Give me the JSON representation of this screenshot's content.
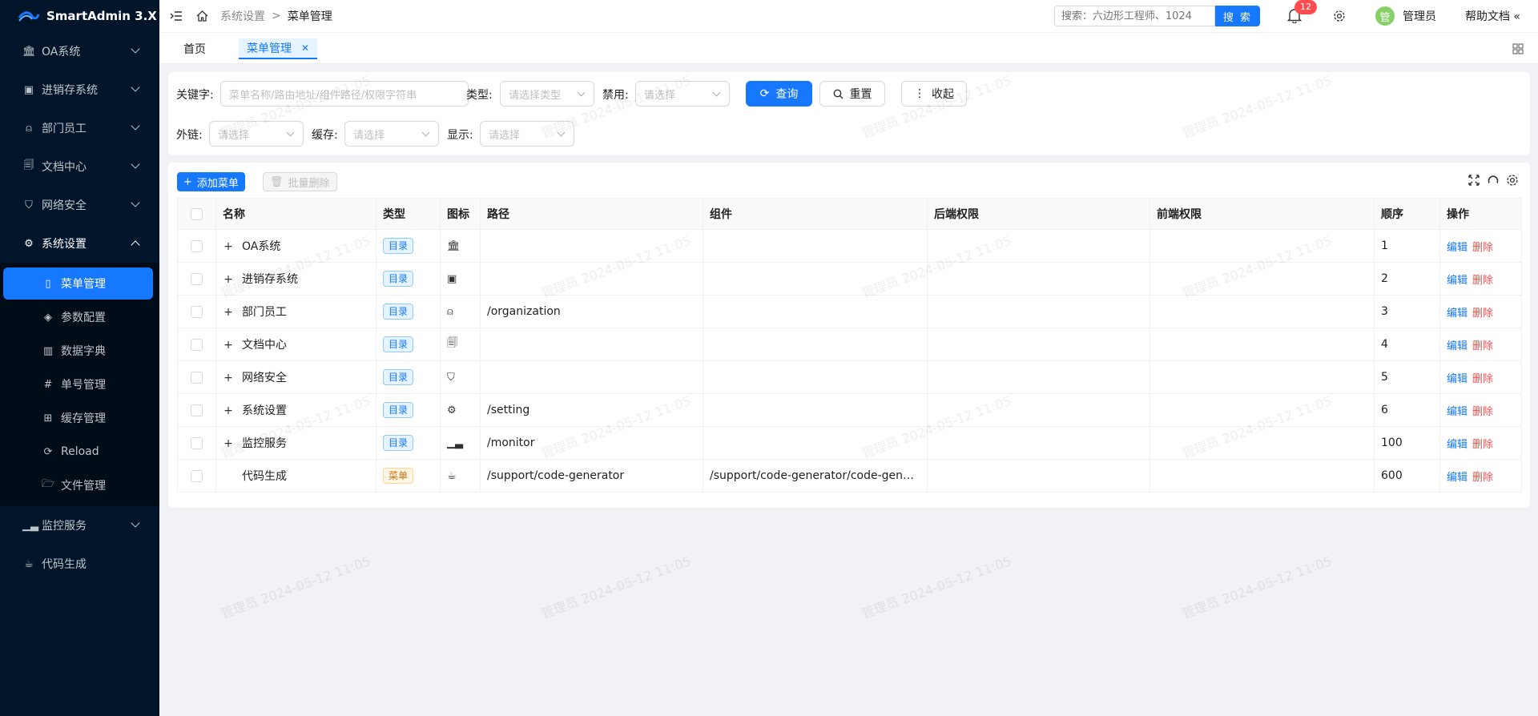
{
  "logo": {
    "title": "SmartAdmin 3.X"
  },
  "sidebar": {
    "groups_top": [
      {
        "label": "OA系统",
        "icon": "bank-icon"
      },
      {
        "label": "进销存系统",
        "icon": "calendar-icon"
      },
      {
        "label": "部门员工",
        "icon": "user-icon"
      },
      {
        "label": "文档中心",
        "icon": "file-search-icon"
      },
      {
        "label": "网络安全",
        "icon": "shield-icon"
      }
    ],
    "open_group": {
      "label": "系统设置",
      "icon": "gear-icon"
    },
    "sub_items": [
      {
        "label": "菜单管理",
        "icon": "file-icon"
      },
      {
        "label": "参数配置",
        "icon": "diamond-icon"
      },
      {
        "label": "数据字典",
        "icon": "barcode-icon"
      },
      {
        "label": "单号管理",
        "icon": "hash-icon"
      },
      {
        "label": "缓存管理",
        "icon": "grid-icon"
      },
      {
        "label": "Reload",
        "icon": "reload-icon"
      },
      {
        "label": "文件管理",
        "icon": "folder-icon"
      }
    ],
    "groups_bottom": [
      {
        "label": "监控服务",
        "icon": "chart-icon"
      },
      {
        "label": "代码生成",
        "icon": "coffee-icon"
      }
    ]
  },
  "header": {
    "breadcrumb": [
      "系统设置",
      ">",
      "菜单管理"
    ],
    "search_placeholder": "搜索：六边形工程师、1024",
    "search_button": "搜 索",
    "notify_count": "12",
    "avatar_char": "管",
    "user_name": "管理员",
    "help": "帮助文档"
  },
  "tabs": [
    {
      "label": "首页"
    },
    {
      "label": "菜单管理"
    }
  ],
  "query": {
    "keyword_label": "关键字:",
    "keyword_placeholder": "菜单名称/路由地址/组件路径/权限字符串",
    "type_label": "类型:",
    "type_placeholder": "请选择类型",
    "disabled_label": "禁用:",
    "disabled_placeholder": "请选择",
    "query_btn": "查询",
    "reset_btn": "重置",
    "collapse_btn": "收起",
    "link_label": "外链:",
    "link_placeholder": "请选择",
    "cache_label": "缓存:",
    "cache_placeholder": "请选择",
    "show_label": "显示:",
    "show_placeholder": "请选择"
  },
  "toolbar": {
    "add": "添加菜单",
    "batch_delete": "批量删除"
  },
  "table": {
    "headers": [
      "名称",
      "类型",
      "图标",
      "路径",
      "组件",
      "后端权限",
      "前端权限",
      "顺序",
      "操作"
    ],
    "edit_label": "编辑",
    "delete_label": "删除",
    "rows": [
      {
        "expand": "+",
        "name": "OA系统",
        "type": "目录",
        "icon": "bank-icon",
        "path": "",
        "component": "",
        "backend": "",
        "frontend": "",
        "order": "1"
      },
      {
        "expand": "+",
        "name": "进销存系统",
        "type": "目录",
        "icon": "calendar-icon",
        "path": "",
        "component": "",
        "backend": "",
        "frontend": "",
        "order": "2"
      },
      {
        "expand": "+",
        "name": "部门员工",
        "type": "目录",
        "icon": "user-icon",
        "path": "/organization",
        "component": "",
        "backend": "",
        "frontend": "",
        "order": "3"
      },
      {
        "expand": "+",
        "name": "文档中心",
        "type": "目录",
        "icon": "file-search-icon",
        "path": "",
        "component": "",
        "backend": "",
        "frontend": "",
        "order": "4"
      },
      {
        "expand": "+",
        "name": "网络安全",
        "type": "目录",
        "icon": "shield-icon",
        "path": "",
        "component": "",
        "backend": "",
        "frontend": "",
        "order": "5"
      },
      {
        "expand": "+",
        "name": "系统设置",
        "type": "目录",
        "icon": "gear-icon",
        "path": "/setting",
        "component": "",
        "backend": "",
        "frontend": "",
        "order": "6"
      },
      {
        "expand": "+",
        "name": "监控服务",
        "type": "目录",
        "icon": "chart-icon",
        "path": "/monitor",
        "component": "",
        "backend": "",
        "frontend": "",
        "order": "100"
      },
      {
        "expand": "",
        "name": "代码生成",
        "type": "菜单",
        "icon": "coffee-icon",
        "path": "/support/code-generator",
        "component": "/support/code-generator/code-generat...",
        "backend": "",
        "frontend": "",
        "order": "600"
      }
    ]
  },
  "watermark": "管理员 2024-05-12 11:05",
  "colors": {
    "primary": "#1677ff",
    "danger": "#ff4d4f",
    "sidebar": "#001529"
  }
}
